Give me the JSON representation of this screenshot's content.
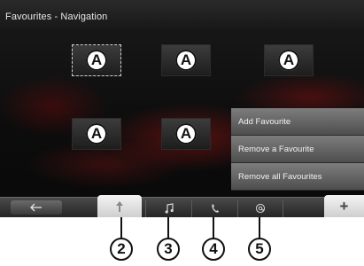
{
  "title": "Favourites - Navigation",
  "favourites": [
    {
      "label": "A",
      "selected": true
    },
    {
      "label": "A",
      "selected": false
    },
    {
      "label": "A",
      "selected": false
    },
    {
      "label": "A",
      "selected": false
    },
    {
      "label": "A",
      "selected": false
    }
  ],
  "menu": {
    "items": [
      "Add Favourite",
      "Remove a Favourite",
      "Remove all Favourites"
    ]
  },
  "tabs": {
    "back_icon": "back-arrow-icon",
    "navigation_icon": "navigation-arrow-icon",
    "music_icon": "music-note-icon",
    "phone_icon": "phone-icon",
    "web_icon": "at-sign-icon",
    "add_label": "+"
  },
  "callouts": [
    "2",
    "3",
    "4",
    "5"
  ]
}
